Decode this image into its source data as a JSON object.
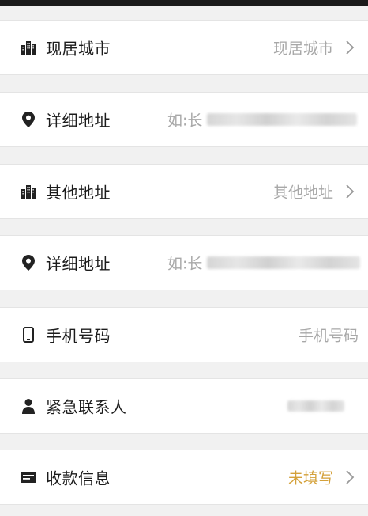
{
  "rows": [
    {
      "id": "city",
      "icon": "buildings-icon",
      "label": "现居城市",
      "value": "现居城市"
    },
    {
      "id": "address1",
      "icon": "location-pin-icon",
      "label": "详细地址",
      "value_prefix": "如:长"
    },
    {
      "id": "other_address",
      "icon": "buildings-icon",
      "label": "其他地址",
      "value": "其他地址"
    },
    {
      "id": "address2",
      "icon": "location-pin-icon",
      "label": "详细地址",
      "value_prefix": "如:长"
    },
    {
      "id": "phone",
      "icon": "phone-icon",
      "label": "手机号码",
      "value": "手机号码"
    },
    {
      "id": "emergency_contact",
      "icon": "person-icon",
      "label": "紧急联系人"
    },
    {
      "id": "payment_info",
      "icon": "message-card-icon",
      "label": "收款信息",
      "value": "未填写",
      "value_color": "#d4a13a"
    }
  ]
}
